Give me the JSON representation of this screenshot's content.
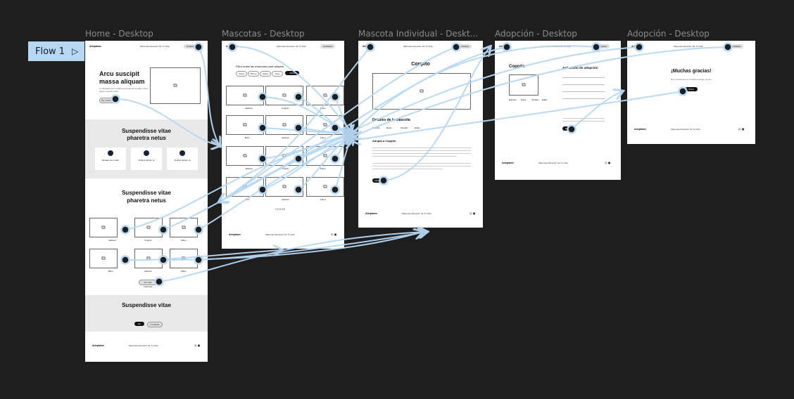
{
  "canvas": {
    "background": "#1e1e1e",
    "wire_color": "#b7d8f3",
    "accent": "#b7d8f3"
  },
  "flow": {
    "label": "Flow 1",
    "icon": "play-icon"
  },
  "frames": {
    "home": {
      "title": "Home - Desktop",
      "logo": "Adoptame",
      "nav_links": "Mascotas  Adopción  Sé  Tu Vida",
      "nav_button": "Contactar",
      "hero_title_1": "Arcu suscipit",
      "hero_title_2": "massa aliquam",
      "hero_text": "In vulputate quis magna vel hendrerit ac dolor. Nunc sapien sed dui nulla.",
      "hero_button": "Ver mascotas",
      "section1_title_1": "Suspendisse vitae",
      "section1_title_2": "pharetra netus",
      "features": [
        "Beatae sem nulla",
        "Finibus dictum ut",
        "Finibus dictum ut"
      ],
      "section2_title_1": "Suspendisse vitae",
      "section2_title_2": "pharetra netus",
      "pets": [
        "Jackson",
        "Coppito",
        "Fideo",
        "Bimo",
        "Jackson",
        "Fideo"
      ],
      "more_button": "Ver más mascotas",
      "section3_title": "Suspendisse vitae",
      "cta_primary": "Ver",
      "cta_secondary": "Contactar",
      "footer_links": "Mascotas  Adopción  Sé  Tu Vida"
    },
    "mascotas": {
      "title": "Mascotas - Desktop",
      "logo": "Adoptame",
      "nav_links": "Mascotas  Adopción  Sé  Tu Vida",
      "nav_button": "Contactar",
      "heading": "Filtra todas las mascotas para adoptar",
      "filters": [
        "Todos",
        "Perros",
        "Gatos",
        "Aves",
        "Otros"
      ],
      "pets": [
        "Jackson",
        "Coppito",
        "Fideo",
        "Bimo",
        "Jackson",
        "Fideo",
        "Jackson",
        "Coppito",
        "Fideo",
        "Bimo",
        "Jackson",
        "Fideo"
      ],
      "pagination": "1 2 3 4 5",
      "footer_links": "Mascotas  Adopción  Sé  Tu Vida"
    },
    "individual": {
      "title": "Mascota Individual - Deskt...",
      "logo": "Adoptame",
      "nav_links": "Mascotas  Adopción  Sé  Tu Vida",
      "nav_button": "Contactar",
      "pet_name": "Coppito",
      "details_title": "Detalles de la mascota",
      "detail_labels": [
        "Especie",
        "Raza",
        "Tamaño",
        "Edad"
      ],
      "adopt_title": "Adopta a Coppito",
      "adopt_button": "Adoptar",
      "footer_links": "Mascotas  Adopción  Sé  Tu Vida"
    },
    "adopcion": {
      "title": "Adopción - Desktop",
      "logo": "Adoptame",
      "nav_links": "Mascotas  Adopción  Sé  Tu Vida",
      "nav_button": "Contactar",
      "pet_name": "Coppito",
      "form_title": "Aplicación de adopción",
      "pet_labels": [
        "Especie",
        "Raza",
        "Tamaño",
        "Edad"
      ],
      "submit_button": "Enviar",
      "footer_links": "Mascotas  Adopción  Sé  Tu Vida"
    },
    "gracias": {
      "title": "Adopción - Desktop",
      "logo": "Adoptame",
      "nav_links": "Mascotas  Adopción  Sé  Tu Vida",
      "nav_button": "Contactar",
      "heading": "¡Muchas gracias!",
      "subtext": "Nos pondremos en contacto contigo pronto.",
      "button": "Volver",
      "footer_links": "Mascotas  Adopción  Sé  Tu Vida"
    }
  }
}
